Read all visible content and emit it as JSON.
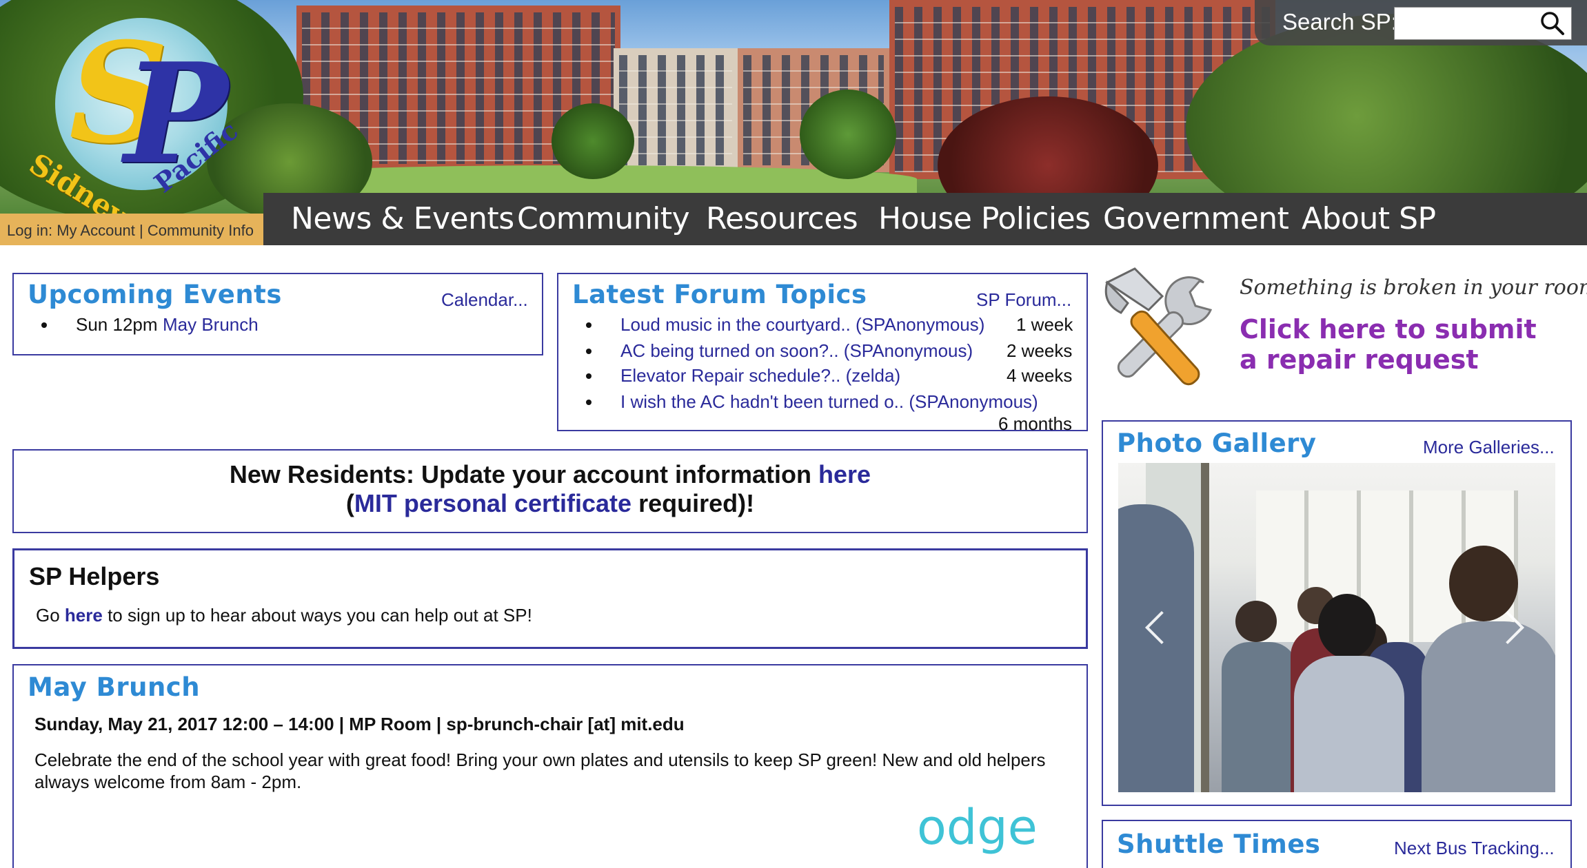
{
  "header": {
    "logo_text": "SidneyPacific",
    "search_label": "Search SP:",
    "search_placeholder": "",
    "login": {
      "prefix": "Log in:",
      "my_account": "My Account",
      "separator": "|",
      "community_info": "Community Info"
    },
    "nav": [
      "News & Events",
      "Community",
      "Resources",
      "House Policies",
      "Government",
      "About SP"
    ]
  },
  "events": {
    "title": "Upcoming Events",
    "more": "Calendar...",
    "items": [
      {
        "time": "Sun 12pm",
        "name": "May Brunch"
      }
    ]
  },
  "forum": {
    "title": "Latest Forum Topics",
    "more": "SP Forum...",
    "items": [
      {
        "topic": "Loud music in the courtyard.. (SPAnonymous)",
        "age": "1 week"
      },
      {
        "topic": "AC being turned on soon?.. (SPAnonymous)",
        "age": "2 weeks"
      },
      {
        "topic": "Elevator Repair schedule?.. (zelda)",
        "age": "4 weeks"
      },
      {
        "topic": "I wish the AC hadn't been turned o.. (SPAnonymous)",
        "age": "6 months"
      }
    ]
  },
  "repair": {
    "question": "Something is broken in your room?",
    "line1": "Click here to submit",
    "line2": "a repair request"
  },
  "residents": {
    "line1_prefix": "New Residents: Update your account information",
    "line1_link": "here",
    "line2_open": "(",
    "line2_link": "MIT personal certificate",
    "line2_suffix": "required)!"
  },
  "helpers": {
    "title": "SP Helpers",
    "prefix": "Go",
    "link": "here",
    "suffix": "to sign up to hear about ways you can help out at SP!"
  },
  "brunch": {
    "title": "May Brunch",
    "details": "Sunday, May 21, 2017 12:00 – 14:00 | MP Room | sp-brunch-chair [at] mit.edu",
    "desc_line1": "Celebrate the end of the school year with great food! Bring your own plates and utensils to keep SP green! New and old helpers",
    "desc_line2": "always welcome from 8am - 2pm.",
    "image_text": "odge"
  },
  "gallery": {
    "title": "Photo Gallery",
    "more": "More Galleries..."
  },
  "shuttle": {
    "title": "Shuttle Times",
    "more": "Next Bus Tracking..."
  },
  "colors": {
    "accent_title": "#2e8ad4",
    "link": "#2a2a9a",
    "border": "#3a3aa0",
    "nav_bg": "#3b3b3b",
    "login_bg": "#e6b35a",
    "repair_purple": "#8a2db0"
  }
}
